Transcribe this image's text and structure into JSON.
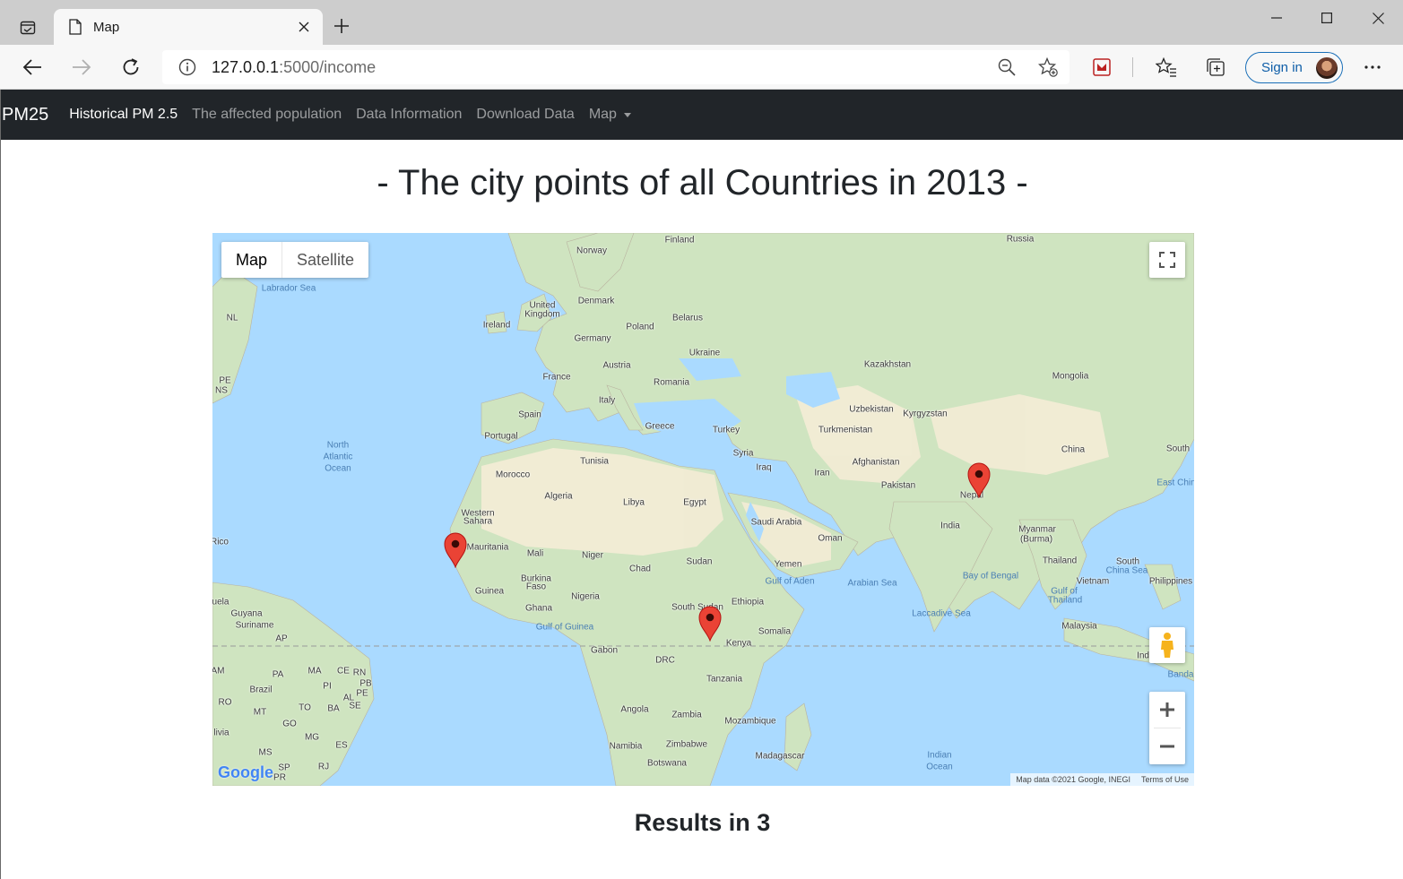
{
  "browser": {
    "tab_title": "Map",
    "url_host": "127.0.0.1",
    "url_path": ":5000/income",
    "signin_label": "Sign in"
  },
  "navbar": {
    "brand": "PM25",
    "links": [
      {
        "label": "Historical PM 2.5",
        "active": true
      },
      {
        "label": "The affected population",
        "active": false
      },
      {
        "label": "Data Information",
        "active": false
      },
      {
        "label": "Download Data",
        "active": false
      },
      {
        "label": "Map",
        "active": false,
        "dropdown": true
      }
    ]
  },
  "page": {
    "title": "- The city points of all Countries in 2013 -",
    "results": "Results in 3"
  },
  "map": {
    "type_buttons": {
      "map": "Map",
      "satellite": "Satellite"
    },
    "attribution": "Map data ©2021 Google, INEGI",
    "terms": "Terms of Use",
    "google_logo": "Google",
    "marker_count": 3,
    "markers": [
      "Western Africa (Senegal coast)",
      "East Africa (Uganda)",
      "Nepal"
    ],
    "labels": [
      {
        "text": "Finland"
      },
      {
        "text": "Russia"
      },
      {
        "text": "Norway"
      },
      {
        "text": "Labrador Sea",
        "sea": true
      },
      {
        "text": "NL"
      },
      {
        "text": "Denmark"
      },
      {
        "text": "United"
      },
      {
        "text": "Kingdom"
      },
      {
        "text": "Belarus"
      },
      {
        "text": "Ireland"
      },
      {
        "text": "Poland"
      },
      {
        "text": "Germany"
      },
      {
        "text": "Ukraine"
      },
      {
        "text": "Austria"
      },
      {
        "text": "Kazakhstan"
      },
      {
        "text": "Mongolia"
      },
      {
        "text": "PE"
      },
      {
        "text": "NS"
      },
      {
        "text": "France"
      },
      {
        "text": "Romania"
      },
      {
        "text": "Italy"
      },
      {
        "text": "Uzbekistan"
      },
      {
        "text": "Kyrgyzstan"
      },
      {
        "text": "Spain"
      },
      {
        "text": "Greece"
      },
      {
        "text": "Turkey"
      },
      {
        "text": "Turkmenistan"
      },
      {
        "text": "Portugal"
      },
      {
        "text": "North",
        "sea": true
      },
      {
        "text": "Atlantic",
        "sea": true
      },
      {
        "text": "Ocean",
        "sea": true
      },
      {
        "text": "China"
      },
      {
        "text": "South"
      },
      {
        "text": "Tunisia"
      },
      {
        "text": "Syria"
      },
      {
        "text": "Afghanistan"
      },
      {
        "text": "Morocco"
      },
      {
        "text": "Iraq"
      },
      {
        "text": "Iran"
      },
      {
        "text": "Pakistan"
      },
      {
        "text": "Nepal"
      },
      {
        "text": "East Chin",
        "sea": true
      },
      {
        "text": "Algeria"
      },
      {
        "text": "Libya"
      },
      {
        "text": "Egypt"
      },
      {
        "text": "Western"
      },
      {
        "text": "Sahara"
      },
      {
        "text": "Saudi Arabia"
      },
      {
        "text": "India"
      },
      {
        "text": "Mauritania"
      },
      {
        "text": "Oman"
      },
      {
        "text": "Myanmar"
      },
      {
        "text": "(Burma)"
      },
      {
        "text": "Rico"
      },
      {
        "text": "Mali"
      },
      {
        "text": "Niger"
      },
      {
        "text": "Sudan"
      },
      {
        "text": "Chad"
      },
      {
        "text": "Yemen"
      },
      {
        "text": "Thailand"
      },
      {
        "text": "South"
      },
      {
        "text": "China Sea",
        "sea": true
      },
      {
        "text": "Burkina"
      },
      {
        "text": "Faso"
      },
      {
        "text": "Gulf of Aden",
        "sea": true
      },
      {
        "text": "Arabian Sea",
        "sea": true
      },
      {
        "text": "Bay of Bengal",
        "sea": true
      },
      {
        "text": "Vietnam"
      },
      {
        "text": "Philippines"
      },
      {
        "text": "Guinea"
      },
      {
        "text": "Nigeria"
      },
      {
        "text": "Gulf of",
        "sea": true
      },
      {
        "text": "Thailand",
        "sea": true
      },
      {
        "text": "uela"
      },
      {
        "text": "Ghana"
      },
      {
        "text": "South Sudan"
      },
      {
        "text": "Ethiopia"
      },
      {
        "text": "Guyana"
      },
      {
        "text": "Suriname"
      },
      {
        "text": "AP"
      },
      {
        "text": "Gulf of Guinea",
        "sea": true
      },
      {
        "text": "Somalia"
      },
      {
        "text": "Laccadive Sea",
        "sea": true
      },
      {
        "text": "Malaysia"
      },
      {
        "text": "Gabon"
      },
      {
        "text": "Kenya"
      },
      {
        "text": "Indonesi"
      },
      {
        "text": "Banda",
        "sea": true
      },
      {
        "text": "AM"
      },
      {
        "text": "PA"
      },
      {
        "text": "MA"
      },
      {
        "text": "CE"
      },
      {
        "text": "RN"
      },
      {
        "text": "PB"
      },
      {
        "text": "PI"
      },
      {
        "text": "PE"
      },
      {
        "text": "DRC"
      },
      {
        "text": "Brazil"
      },
      {
        "text": "AL"
      },
      {
        "text": "SE"
      },
      {
        "text": "Tanzania"
      },
      {
        "text": "RO"
      },
      {
        "text": "MT"
      },
      {
        "text": "TO"
      },
      {
        "text": "BA"
      },
      {
        "text": "Angola"
      },
      {
        "text": "Zambia"
      },
      {
        "text": "Mozambique"
      },
      {
        "text": "GO"
      },
      {
        "text": "livia"
      },
      {
        "text": "MG"
      },
      {
        "text": "ES"
      },
      {
        "text": "Namibia"
      },
      {
        "text": "Zimbabwe"
      },
      {
        "text": "MS"
      },
      {
        "text": "Madagascar"
      },
      {
        "text": "Indian",
        "sea": true
      },
      {
        "text": "Ocean",
        "sea": true
      },
      {
        "text": "SP"
      },
      {
        "text": "RJ"
      },
      {
        "text": "Botswana"
      },
      {
        "text": "PR"
      }
    ]
  }
}
